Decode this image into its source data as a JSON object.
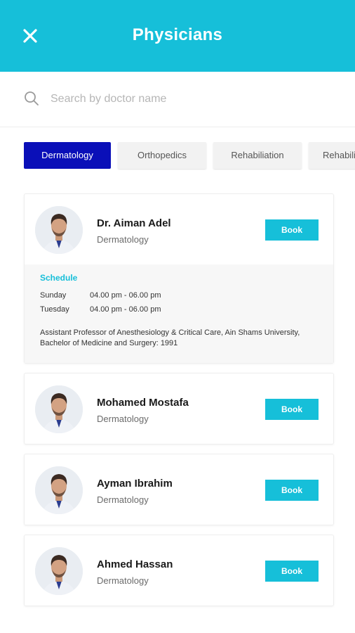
{
  "header": {
    "title": "Physicians",
    "close_icon": "close-icon",
    "bg_color": "#16bfd9"
  },
  "search": {
    "placeholder": "Search by doctor name",
    "value": ""
  },
  "specialties": [
    {
      "label": "Dermatology",
      "active": true
    },
    {
      "label": "Orthopedics",
      "active": false
    },
    {
      "label": "Rehabiliation",
      "active": false
    },
    {
      "label": "Rehabiliation",
      "active": false
    }
  ],
  "doctors": [
    {
      "name": "Dr. Aiman Adel",
      "specialty": "Dermatology",
      "book_label": "Book",
      "expanded": true,
      "schedule_title": "Schedule",
      "schedule": [
        {
          "day": "Sunday",
          "time": "04.00 pm - 06.00 pm"
        },
        {
          "day": "Tuesday",
          "time": "04.00 pm - 06.00 pm"
        }
      ],
      "bio": "Assistant Professor of Anesthesiology & Critical Care, Ain Shams University, Bachelor of Medicine and Surgery: 1991"
    },
    {
      "name": "Mohamed Mostafa",
      "specialty": "Dermatology",
      "book_label": "Book"
    },
    {
      "name": "Ayman Ibrahim",
      "specialty": "Dermatology",
      "book_label": "Book"
    },
    {
      "name": "Ahmed Hassan",
      "specialty": "Dermatology",
      "book_label": "Book"
    }
  ],
  "colors": {
    "accent": "#16bfd9",
    "active_chip": "#0a0fb8"
  }
}
